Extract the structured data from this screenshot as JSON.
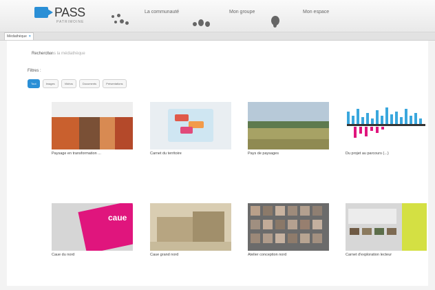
{
  "header": {
    "logo_text": "PASS",
    "logo_sub": "PATRIMOINE",
    "nav": [
      {
        "label": "La communauté",
        "icon": "people-group-icon"
      },
      {
        "label": "Mon groupe",
        "icon": "group-icon"
      },
      {
        "label": "Mon espace",
        "icon": "person-icon"
      }
    ]
  },
  "tab": {
    "label": "Médiathèque"
  },
  "search": {
    "label": "Rechercher",
    "placeholder": "dans la médiathèque"
  },
  "filters": {
    "label": "Filtres :",
    "chips": [
      {
        "label": "Tout",
        "active": true
      },
      {
        "label": "Images",
        "active": false
      },
      {
        "label": "Vidéos",
        "active": false
      },
      {
        "label": "Documents",
        "active": false
      },
      {
        "label": "Présentations",
        "active": false
      }
    ]
  },
  "cards": [
    {
      "caption": "Paysage en transformation ..."
    },
    {
      "caption": "Carnet du territoire"
    },
    {
      "caption": "Pays de paysages"
    },
    {
      "caption": "Du projet au parcours (...)"
    },
    {
      "caption": "Caue du nord"
    },
    {
      "caption": "Caue grand nord"
    },
    {
      "caption": "Atelier conception nord"
    },
    {
      "caption": "Carnet d'exploration lecteur"
    }
  ],
  "card_thumb_text": "caue",
  "colors": {
    "accent": "#2a8fd6",
    "magenta": "#e0157d",
    "cyan": "#3aa7dd"
  }
}
